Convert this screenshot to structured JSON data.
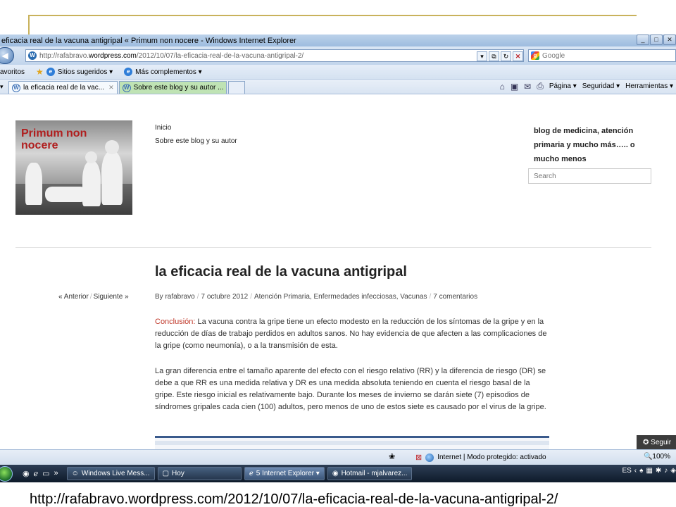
{
  "window": {
    "title": "eficacia real de la vacuna antigripal « Primum non nocere - Windows Internet Explorer",
    "buttons": [
      "_",
      "□",
      "✕"
    ]
  },
  "address": {
    "url_prefix": "http://rafabravo.",
    "url_host": "wordpress.com",
    "url_path": "/2012/10/07/la-eficacia-real-de-la-vacuna-antigripal-2/",
    "search_placeholder": "Google"
  },
  "favorites": {
    "label": "avoritos",
    "items": [
      {
        "label": "Sitios sugeridos ▾"
      },
      {
        "label": "Más complementos ▾"
      }
    ]
  },
  "tabs": [
    {
      "label": "la eficacia real de la vac...",
      "close": "✕"
    },
    {
      "label": "Sobre este blog y su autor ..."
    }
  ],
  "command_bar": {
    "page": "Página ▾",
    "security": "Seguridad ▾",
    "tools": "Herramientas ▾"
  },
  "site": {
    "name": "Primum non nocere",
    "nav": [
      "Inicio",
      "Sobre este blog y su autor"
    ],
    "tagline": "blog de medicina, atención primaria y mucho más….. o mucho menos",
    "search_placeholder": "Search"
  },
  "post": {
    "title": "la eficacia real de la vacuna antigripal",
    "prev": "« Anterior",
    "next": "Siguiente »",
    "meta": {
      "author": "By rafabravo",
      "date": "7 octubre 2012",
      "categories": "Atención Primaria, Enfermedades infecciosas, Vacunas",
      "comments": "7 comentarios"
    },
    "conclusion_label": "Conclusión:",
    "para1": " La vacuna contra la gripe tiene un efecto modesto en la reducción de los síntomas de la gripe y en la reducción de días de trabajo perdidos en adultos sanos. No hay evidencia de que afecten a las complicaciones de la gripe (como neumonía), o a la transmisión de esta.",
    "para2": "La gran diferencia entre el tamaño aparente del efecto con el riesgo relativo (RR) y la diferencia de riesgo (DR) se debe a que RR es una medida relativa y DR es una medida absoluta teniendo en cuenta el riesgo basal de la gripe. Este riesgo inicial es relativamente bajo. Durante los meses de invierno se darán siete (7) episodios de síndromes gripales cada cien (100) adultos, pero menos de uno de estos siete es causado por el virus de la gripe."
  },
  "follow_button": "✪ Seguir",
  "status": {
    "protected": "Internet | Modo protegido: activado",
    "zoom": "🔍100%"
  },
  "taskbar": {
    "items": [
      {
        "label": "Windows Live Mess..."
      },
      {
        "label": "Hoy"
      },
      {
        "label": "5 Internet Explorer ▾"
      },
      {
        "label": "Hotmail - mjalvarez..."
      }
    ],
    "lang": "ES"
  },
  "caption": "http://rafabravo.wordpress.com/2012/10/07/la-eficacia-real-de-la-vacuna-antigripal-2/",
  "colors": {
    "accent_line": "#c9b25c",
    "site_name": "#b01e1e",
    "conclusion": "#c0392b"
  }
}
